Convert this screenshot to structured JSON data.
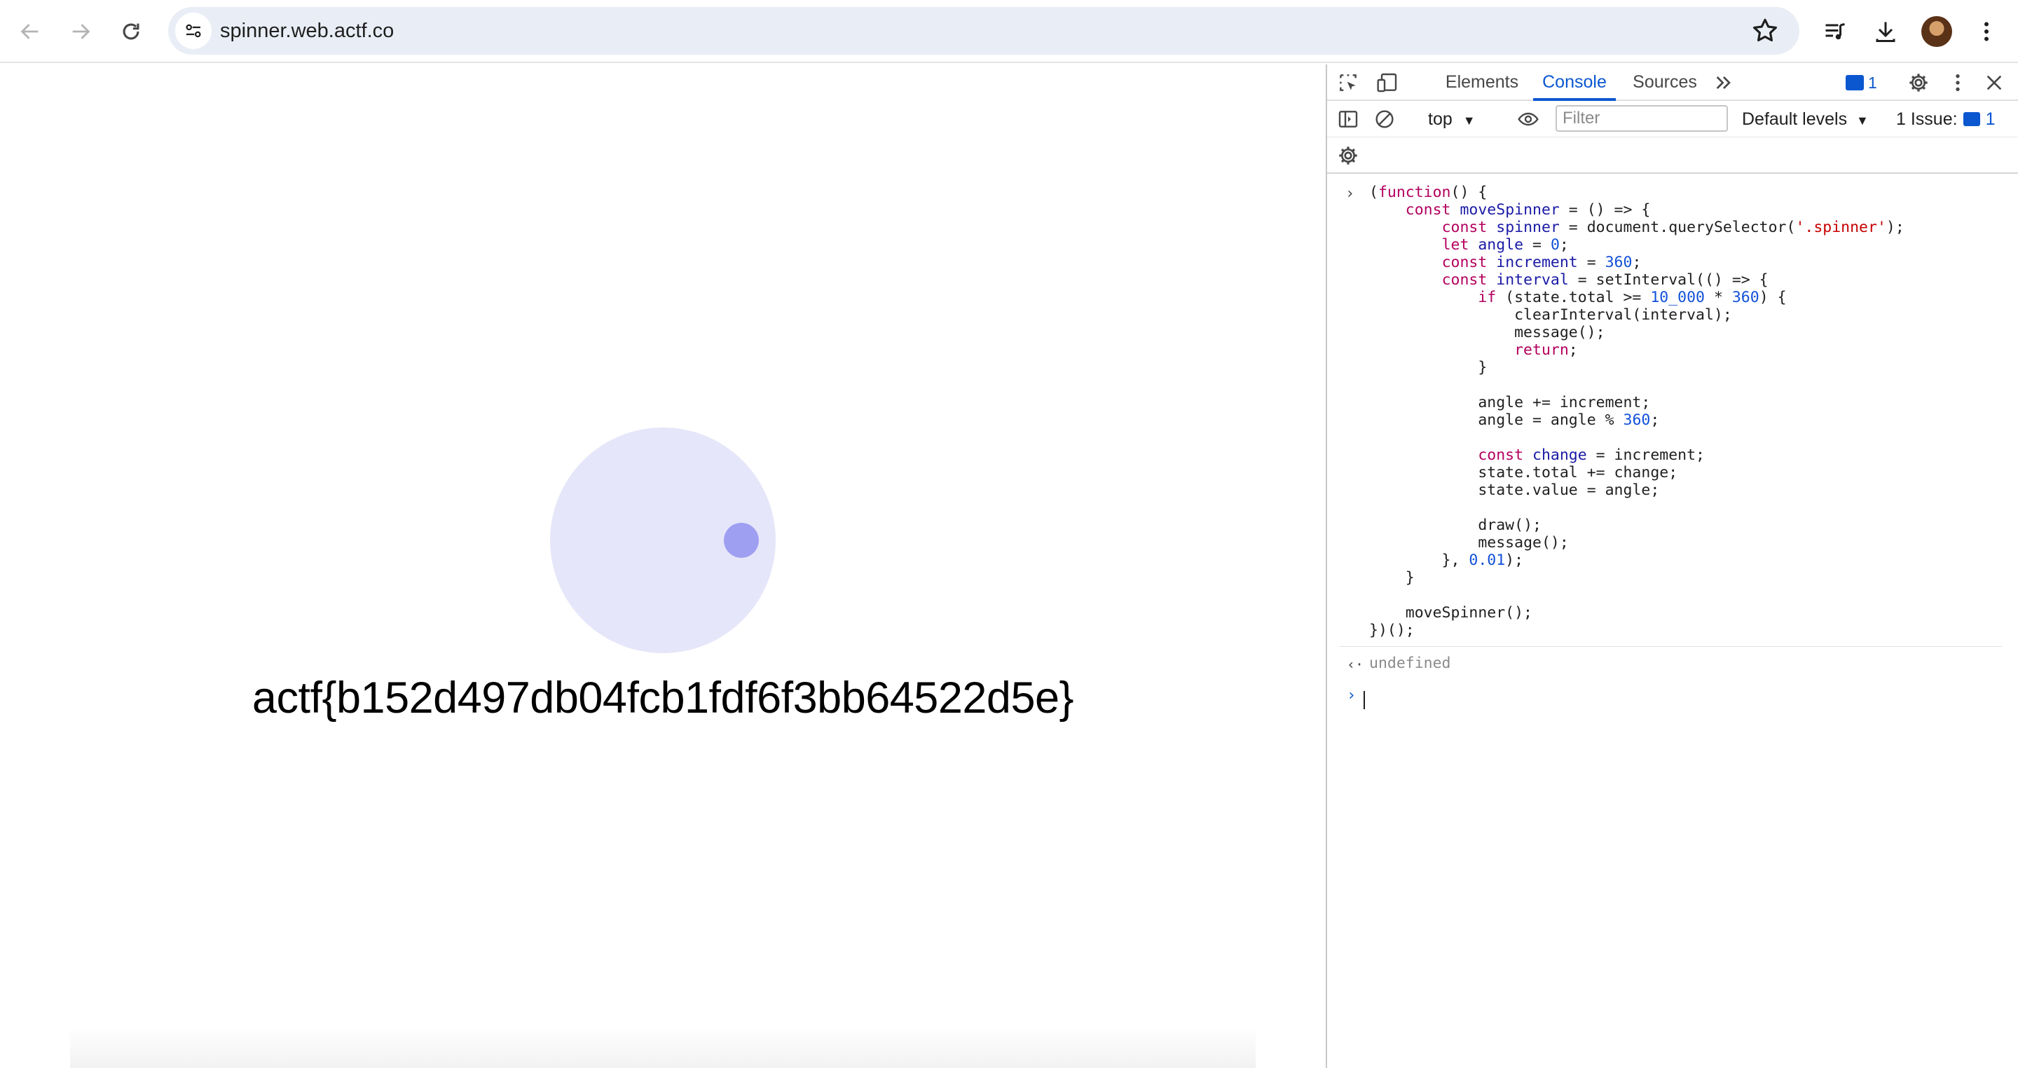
{
  "browser": {
    "url": "spinner.web.actf.co"
  },
  "page": {
    "flag_text": "actf{b152d497db04fcb1fdf6f3bb64522d5e}"
  },
  "devtools": {
    "tabs": [
      "Elements",
      "Console",
      "Sources"
    ],
    "active_tab": "Console",
    "message_count": "1",
    "context": "top",
    "filter_placeholder": "Filter",
    "levels_label": "Default levels",
    "issues_label": "1 Issue:",
    "issues_count": "1",
    "console": {
      "code_lines": [
        "(function() {",
        "    const moveSpinner = () => {",
        "        const spinner = document.querySelector('.spinner');",
        "        let angle = 0;",
        "        const increment = 360;",
        "        const interval = setInterval(() => {",
        "            if (state.total >= 10_000 * 360) {",
        "                clearInterval(interval);",
        "                message();",
        "                return;",
        "            }",
        "",
        "            angle += increment;",
        "            angle = angle % 360;",
        "",
        "            const change = increment;",
        "            state.total += change;",
        "            state.value = angle;",
        "",
        "            draw();",
        "            message();",
        "        }, 0.01);",
        "    }",
        "",
        "    moveSpinner();",
        "})();"
      ],
      "result": "undefined"
    }
  },
  "colors": {
    "spinner_bg": "#e6e6fa",
    "spinner_dot": "#9f9ff2",
    "accent": "#0b57d0"
  },
  "icons": [
    "back-icon",
    "forward-icon",
    "reload-icon",
    "site-info-icon",
    "bookmark-star-icon",
    "media-icon",
    "download-icon",
    "avatar",
    "more-icon",
    "inspect-icon",
    "device-toolbar-icon",
    "more-tabs-icon",
    "message-icon",
    "settings-icon",
    "kebab-icon",
    "close-icon",
    "sidebar-icon",
    "clear-console-icon",
    "eye-icon",
    "console-settings-icon"
  ]
}
